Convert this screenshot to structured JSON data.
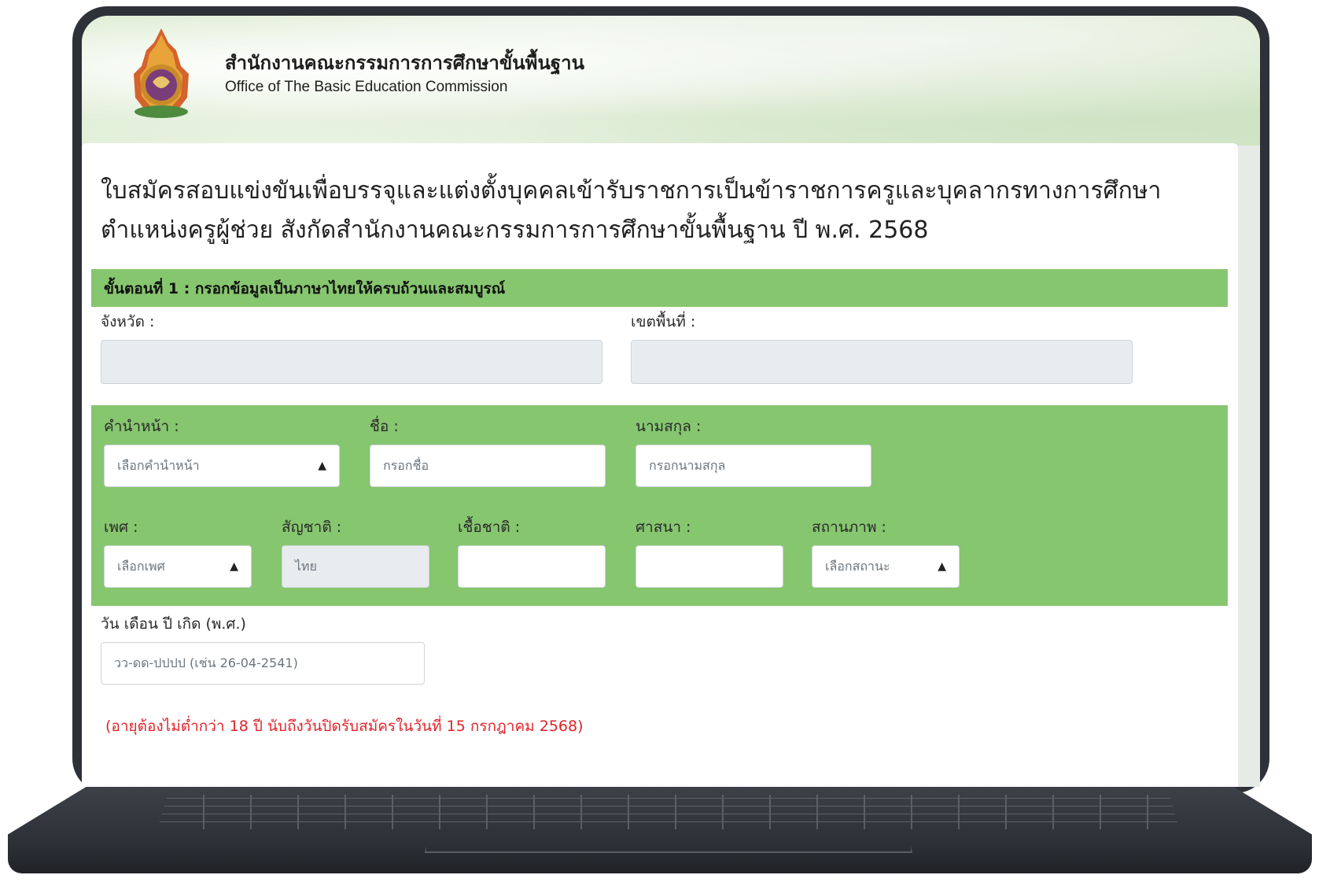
{
  "header": {
    "org_name_th": "สำนักงานคณะกรรมการการศึกษาขั้นพื้นฐาน",
    "org_name_en": "Office of The Basic Education Commission"
  },
  "form": {
    "title": "ใบสมัครสอบแข่งขันเพื่อบรรจุและแต่งตั้งบุคคลเข้ารับราชการเป็นข้าราชการครูและบุคลากรทางการศึกษา ตำแหน่งครูผู้ช่วย สังกัดสำนักงานคณะกรรมการการศึกษาขั้นพื้นฐาน ปี พ.ศ. 2568",
    "step_label": "ขั้นตอนที่ 1 : กรอกข้อมูลเป็นภาษาไทยให้ครบถ้วนและสมบูรณ์",
    "province": {
      "label": "จังหวัด :",
      "value": ""
    },
    "area": {
      "label": "เขตพื้นที่ :",
      "value": ""
    },
    "prefix": {
      "label": "คำนำหน้า :",
      "value": "เลือกคำนำหน้า"
    },
    "first_name": {
      "label": "ชื่อ :",
      "placeholder": "กรอกชื่อ"
    },
    "last_name": {
      "label": "นามสกุล :",
      "placeholder": "กรอกนามสกุล"
    },
    "gender": {
      "label": "เพศ :",
      "value": "เลือกเพศ"
    },
    "nationality": {
      "label": "สัญชาติ :",
      "value": "ไทย"
    },
    "ethnicity": {
      "label": "เชื้อชาติ :",
      "value": ""
    },
    "religion": {
      "label": "ศาสนา :",
      "value": ""
    },
    "status": {
      "label": "สถานภาพ :",
      "value": "เลือกสถานะ"
    },
    "birthdate": {
      "label": "วัน เดือน ปี เกิด (พ.ศ.)",
      "placeholder": "วว-ดด-ปปปป (เช่น 26-04-2541)"
    },
    "age_note": "(อายุต้องไม่ต่ำกว่า 18 ปี นับถึงวันปิดรับสมัครในวันที่ 15 กรกฎาคม 2568)"
  },
  "colors": {
    "accent_green": "#86c66f",
    "warning_red": "#e0242a",
    "frame": "#2e3138"
  },
  "icons": {
    "logo": "obec-emblem-icon",
    "select_caret": "sort-caret-icon"
  }
}
